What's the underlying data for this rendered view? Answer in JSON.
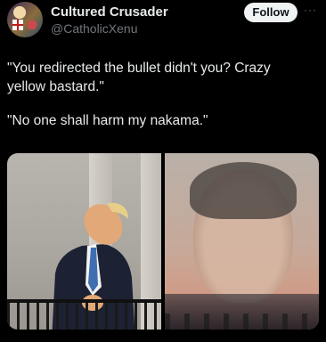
{
  "user": {
    "name": "Cultured Crusader",
    "handle": "@CatholicXenu"
  },
  "actions": {
    "follow_label": "Follow",
    "more_label": "···"
  },
  "tweet": {
    "paragraphs": [
      "\"You redirected the bullet didn't you? Crazy yellow bastard.\"",
      "\"No one shall harm my nakama.\""
    ]
  }
}
